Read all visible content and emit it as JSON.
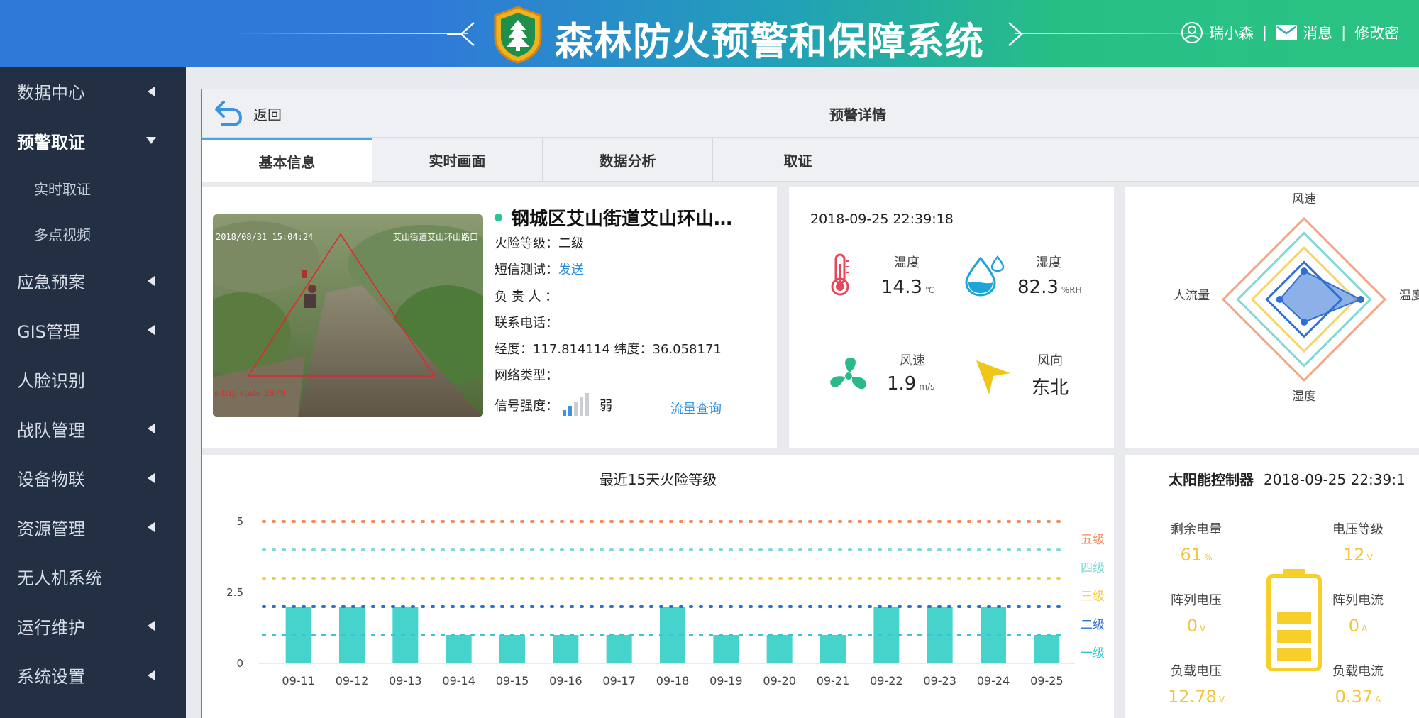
{
  "header": {
    "app_title": "森林防火预警和保障系统",
    "user_name": "瑞小森",
    "separator": "|",
    "messages_label": "消息",
    "change_password_label": "修改密"
  },
  "sidebar": {
    "items": [
      {
        "label": "数据中心",
        "arrow": "left"
      },
      {
        "label": "预警取证",
        "arrow": "down",
        "active": true
      },
      {
        "label": "实时取证",
        "sub": true
      },
      {
        "label": "多点视频",
        "sub": true
      },
      {
        "label": "应急预案",
        "arrow": "left"
      },
      {
        "label": "GIS管理",
        "arrow": "left"
      },
      {
        "label": "人脸识别"
      },
      {
        "label": "战队管理",
        "arrow": "left"
      },
      {
        "label": "设备物联",
        "arrow": "left"
      },
      {
        "label": "资源管理",
        "arrow": "left"
      },
      {
        "label": "无人机系统"
      },
      {
        "label": "运行维护",
        "arrow": "left"
      },
      {
        "label": "系统设置",
        "arrow": "left"
      }
    ]
  },
  "topbar": {
    "back_label": "返回",
    "page_title": "预警详情"
  },
  "tabs": [
    {
      "label": "基本信息",
      "active": true
    },
    {
      "label": "实时画面"
    },
    {
      "label": "数据分析"
    },
    {
      "label": "取证"
    }
  ],
  "info": {
    "location_title": "钢城区艾山街道艾山环山…",
    "snapshot_overlay_time": "2018/08/31 15:04:24",
    "snapshot_overlay_place": "艾山街道艾山环山路口",
    "snapshot_overlay_bottom": "s trip state 2879",
    "fire_level_label": "火险等级：",
    "fire_level_value": "二级",
    "sms_label": "短信测试：",
    "sms_link": "发送",
    "owner_label": "负 责 人 ：",
    "phone_label": "联系电话：",
    "coords_text": "经度：117.814114 纬度：36.058171",
    "network_label": "网络类型：",
    "signal_label": "信号强度：",
    "signal_value": "弱",
    "signal_bars_active": 2,
    "signal_bars_total": 5,
    "traffic_link": "流量查询"
  },
  "weather": {
    "time": "2018-09-25 22:39:18",
    "temperature_label": "温度",
    "temperature_value": "14.3",
    "temperature_unit": "℃",
    "humidity_label": "湿度",
    "humidity_value": "82.3",
    "humidity_unit": "%RH",
    "wind_speed_label": "风速",
    "wind_speed_value": "1.9",
    "wind_speed_unit": "m/s",
    "wind_dir_label": "风向",
    "wind_dir_value": "东北"
  },
  "radar": {
    "top_label": "风速",
    "right_label": "温度",
    "bottom_label": "湿度",
    "left_label": "人流量",
    "values": {
      "top": 0.35,
      "right": 0.7,
      "bottom": 0.28,
      "left": 0.3
    },
    "ring_colors": [
      "#f4a582",
      "#7fd8d4",
      "#f7d46a",
      "#2e6fd6"
    ]
  },
  "chart_data": {
    "type": "bar",
    "title": "最近15天火险等级",
    "categories": [
      "09-11",
      "09-12",
      "09-13",
      "09-14",
      "09-15",
      "09-16",
      "09-17",
      "09-18",
      "09-19",
      "09-20",
      "09-21",
      "09-22",
      "09-23",
      "09-24",
      "09-25"
    ],
    "values": [
      2,
      2,
      2,
      1,
      1,
      1,
      1,
      2,
      1,
      1,
      1,
      2,
      2,
      2,
      1
    ],
    "ylim": [
      0,
      5
    ],
    "yticks": [
      "0",
      "2.5",
      "5"
    ],
    "bar_color": "#45d3cc",
    "levels": [
      {
        "name": "五级",
        "value": 5,
        "color": "#f28c5c"
      },
      {
        "name": "四级",
        "value": 4,
        "color": "#7fd8d4"
      },
      {
        "name": "三级",
        "value": 3,
        "color": "#f4cd48"
      },
      {
        "name": "二级",
        "value": 2,
        "color": "#2e6fd6"
      },
      {
        "name": "一级",
        "value": 1,
        "color": "#36c4d6"
      }
    ]
  },
  "solar": {
    "title": "太阳能控制器",
    "time": "2018-09-25 22:39:1",
    "remaining_label": "剩余电量",
    "remaining_value": "61",
    "remaining_unit": "%",
    "voltage_level_label": "电压等级",
    "voltage_level_value": "12",
    "voltage_level_unit": "V",
    "array_voltage_label": "阵列电压",
    "array_voltage_value": "0",
    "array_voltage_unit": "V",
    "array_current_label": "阵列电流",
    "array_current_value": "0",
    "array_current_unit": "A",
    "load_voltage_label": "负载电压",
    "load_voltage_value": "12.78",
    "load_voltage_unit": "V",
    "load_current_label": "负载电流",
    "load_current_value": "0.37",
    "load_current_unit": "A",
    "battery_color": "#f6cf2a"
  }
}
